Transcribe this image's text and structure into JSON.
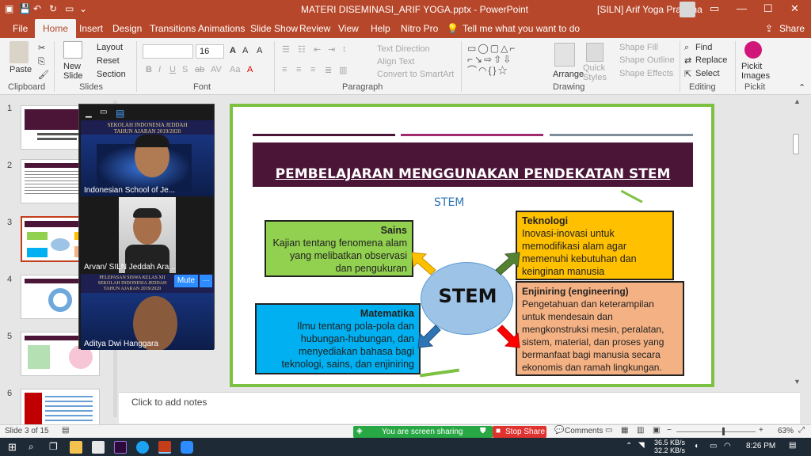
{
  "titlebar": {
    "title": "MATERI DISEMINASI_ARIF YOGA.pptx  -  PowerPoint",
    "user": "[SILN] Arif Yoga Pratama",
    "minimize": "—",
    "maximize": "☐",
    "close": "✕"
  },
  "tabs": {
    "file": "File",
    "home": "Home",
    "insert": "Insert",
    "design": "Design",
    "transitions": "Transitions",
    "animations": "Animations",
    "slideshow": "Slide Show",
    "review": "Review",
    "view": "View",
    "help": "Help",
    "nitro": "Nitro Pro",
    "tellme": "Tell me what you want to do",
    "share": "Share"
  },
  "ribbon": {
    "paste": "Paste",
    "new_slide": "New Slide",
    "layout": "Layout",
    "reset": "Reset",
    "section": "Section",
    "font_size": "16",
    "text_direction": "Text Direction",
    "align_text": "Align Text",
    "convert_smartart": "Convert to SmartArt",
    "arrange": "Arrange",
    "quick_styles": "Quick Styles",
    "shape_fill": "Shape Fill",
    "shape_outline": "Shape Outline",
    "shape_effects": "Shape Effects",
    "find": "Find",
    "replace": "Replace",
    "select": "Select",
    "pickit": "Pickit Images",
    "groups": {
      "clipboard": "Clipboard",
      "slides": "Slides",
      "font": "Font",
      "paragraph": "Paragraph",
      "drawing": "Drawing",
      "editing": "Editing",
      "pickit": "Pickit"
    }
  },
  "thumbs": [
    "1",
    "2",
    "3",
    "4",
    "5",
    "6"
  ],
  "zoom": {
    "participants": [
      {
        "name": "Indonesian School of Je..."
      },
      {
        "name": "Arvan/ SILN Jeddah Ara..."
      },
      {
        "name": "Aditya Dwi Hanggara"
      }
    ],
    "banner_line1": "SEKOLAH INDONESIA JEDDAH",
    "banner_line2": "TAHUN AJARAN 2019/2020",
    "banner3_line1": "PELEPASAN SISWA KELAS XII",
    "banner3_line2": "SEKOLAH INDONESIA JEDDAH",
    "banner3_line3": "TAHUN AJARAN 2019/2020",
    "mute_label": "Mute",
    "more_label": "···"
  },
  "slide": {
    "title": "PEMBELAJARAN MENGGUNAKAN PENDEKATAN STEM",
    "stem_label": "STEM",
    "center": "STEM",
    "sains": {
      "heading": "Sains",
      "body": "Kajian tentang fenomena alam yang melibatkan observasi dan pengukuran"
    },
    "teknologi": {
      "heading": "Teknologi",
      "body": "Inovasi-inovasi untuk memodifikasi alam agar memenuhi kebutuhan dan keinginan manusia"
    },
    "matematika": {
      "heading": "Matematika",
      "body": "Ilmu tentang pola-pola dan hubungan-hubungan, dan menyediakan bahasa bagi teknologi, sains, dan enjiniring"
    },
    "enjiniring": {
      "heading": "Enjiniring (engineering)",
      "body": "Pengetahuan dan keterampilan untuk mendesain dan mengkonstruksi mesin, peralatan, sistem, material, dan proses yang bermanfaat bagi manusia secara ekonomis dan ramah lingkungan."
    },
    "colors": {
      "sains": "#92d050",
      "teknologi": "#ffc000",
      "matematika": "#00b0f0",
      "enjiniring": "#f4b183",
      "center": "#9dc3e6"
    }
  },
  "notes": {
    "placeholder": "Click to add notes"
  },
  "status": {
    "slide_of": "Slide 3 of 15",
    "screen_sharing": "You are screen sharing",
    "stop_share": "Stop Share",
    "comments": "Comments",
    "zoom_level": "63%"
  },
  "taskbar": {
    "net_up": "36.5 KB/s",
    "net_down": "32.2 KB/s",
    "time": "8:26 PM"
  }
}
